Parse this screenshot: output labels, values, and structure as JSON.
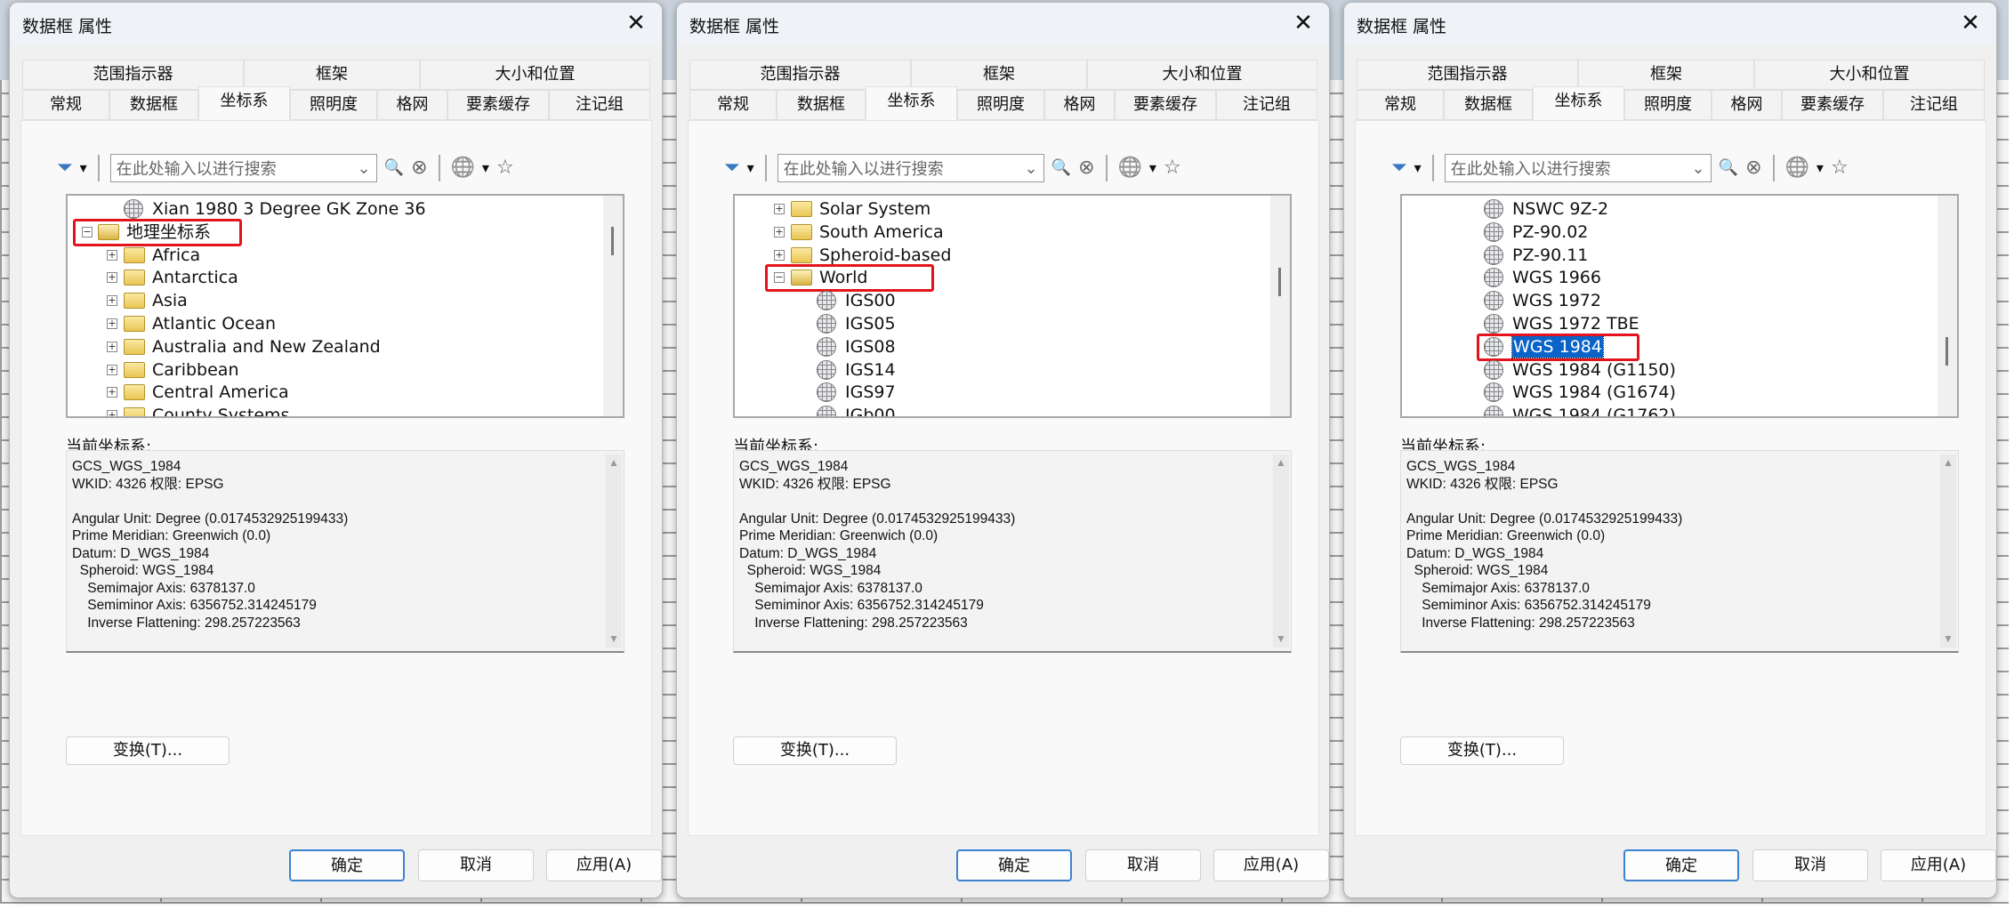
{
  "colors": {
    "highlight_box": "#e3141b",
    "selection": "#0a63c9",
    "primary_border": "#3b83d1"
  },
  "dialogs": [
    {
      "title": "数据框 属性",
      "close_icon": "close-icon",
      "tabs_top": [
        "范围指示器",
        "框架",
        "大小和位置"
      ],
      "tabs_bottom": [
        "常规",
        "数据框",
        "坐标系",
        "照明度",
        "格网",
        "要素缓存",
        "注记组"
      ],
      "active_tab": "坐标系",
      "search_placeholder": "在此处输入以进行搜索",
      "tree_scroll_position": 0.15,
      "tree": [
        {
          "text": "Xian 1980 3 Degree GK Zone 36",
          "level": 1,
          "icon": "globe-icon",
          "expander": ""
        },
        {
          "text": "地理坐标系",
          "level": 0,
          "icon": "folder-open-icon",
          "expander": "-",
          "highlighted": true
        },
        {
          "text": "Africa",
          "level": 1,
          "icon": "folder-icon",
          "expander": "+"
        },
        {
          "text": "Antarctica",
          "level": 1,
          "icon": "folder-icon",
          "expander": "+"
        },
        {
          "text": "Asia",
          "level": 1,
          "icon": "folder-icon",
          "expander": "+"
        },
        {
          "text": "Atlantic Ocean",
          "level": 1,
          "icon": "folder-icon",
          "expander": "+"
        },
        {
          "text": "Australia and New Zealand",
          "level": 1,
          "icon": "folder-icon",
          "expander": "+"
        },
        {
          "text": "Caribbean",
          "level": 1,
          "icon": "folder-icon",
          "expander": "+"
        },
        {
          "text": "Central America",
          "level": 1,
          "icon": "folder-icon",
          "expander": "+"
        },
        {
          "text": "County Systems",
          "level": 1,
          "icon": "folder-icon",
          "expander": "+"
        }
      ]
    },
    {
      "title": "数据框 属性",
      "close_icon": "close-icon",
      "tabs_top": [
        "范围指示器",
        "框架",
        "大小和位置"
      ],
      "tabs_bottom": [
        "常规",
        "数据框",
        "坐标系",
        "照明度",
        "格网",
        "要素缓存",
        "注记组"
      ],
      "active_tab": "坐标系",
      "search_placeholder": "在此处输入以进行搜索",
      "tree_scroll_position": 0.35,
      "tree": [
        {
          "text": "Solar System",
          "level": 1,
          "icon": "folder-icon",
          "expander": "+"
        },
        {
          "text": "South America",
          "level": 1,
          "icon": "folder-icon",
          "expander": "+"
        },
        {
          "text": "Spheroid-based",
          "level": 1,
          "icon": "folder-icon",
          "expander": "+"
        },
        {
          "text": "World",
          "level": 1,
          "icon": "folder-open-icon",
          "expander": "-",
          "highlighted": true
        },
        {
          "text": "IGS00",
          "level": 2,
          "icon": "globe-icon",
          "expander": ""
        },
        {
          "text": "IGS05",
          "level": 2,
          "icon": "globe-icon",
          "expander": ""
        },
        {
          "text": "IGS08",
          "level": 2,
          "icon": "globe-icon",
          "expander": ""
        },
        {
          "text": "IGS14",
          "level": 2,
          "icon": "globe-icon",
          "expander": ""
        },
        {
          "text": "IGS97",
          "level": 2,
          "icon": "globe-icon",
          "expander": ""
        },
        {
          "text": "IGb00",
          "level": 2,
          "icon": "globe-icon",
          "expander": ""
        }
      ]
    },
    {
      "title": "数据框 属性",
      "close_icon": "close-icon",
      "tabs_top": [
        "范围指示器",
        "框架",
        "大小和位置"
      ],
      "tabs_bottom": [
        "常规",
        "数据框",
        "坐标系",
        "照明度",
        "格网",
        "要素缓存",
        "注记组"
      ],
      "active_tab": "坐标系",
      "search_placeholder": "在此处输入以进行搜索",
      "tree_scroll_position": 0.69,
      "tree": [
        {
          "text": "NSWC 9Z-2",
          "level": 2,
          "icon": "globe-icon",
          "expander": ""
        },
        {
          "text": "PZ-90.02",
          "level": 2,
          "icon": "globe-icon",
          "expander": ""
        },
        {
          "text": "PZ-90.11",
          "level": 2,
          "icon": "globe-icon",
          "expander": ""
        },
        {
          "text": "WGS 1966",
          "level": 2,
          "icon": "globe-icon",
          "expander": ""
        },
        {
          "text": "WGS 1972",
          "level": 2,
          "icon": "globe-icon",
          "expander": ""
        },
        {
          "text": "WGS 1972 TBE",
          "level": 2,
          "icon": "globe-icon",
          "expander": ""
        },
        {
          "text": "WGS 1984",
          "level": 2,
          "icon": "globe-icon",
          "expander": "",
          "highlighted": true,
          "selected": true
        },
        {
          "text": "WGS 1984 (G1150)",
          "level": 2,
          "icon": "globe-icon",
          "expander": ""
        },
        {
          "text": "WGS 1984 (G1674)",
          "level": 2,
          "icon": "globe-icon",
          "expander": ""
        },
        {
          "text": "WGS 1984 (G1762)",
          "level": 2,
          "icon": "globe-icon",
          "expander": ""
        }
      ]
    }
  ],
  "current_label": "当前坐标系:",
  "info_lines": [
    "GCS_WGS_1984",
    "WKID: 4326 权限: EPSG",
    "",
    "Angular Unit: Degree (0.0174532925199433)",
    "Prime Meridian: Greenwich (0.0)",
    "Datum: D_WGS_1984",
    "  Spheroid: WGS_1984",
    "    Semimajor Axis: 6378137.0",
    "    Semiminor Axis: 6356752.314245179",
    "    Inverse Flattening: 298.257223563"
  ],
  "transform_button": "变换(T)...",
  "ok_button": "确定",
  "cancel_button": "取消",
  "apply_button": "应用(A)"
}
